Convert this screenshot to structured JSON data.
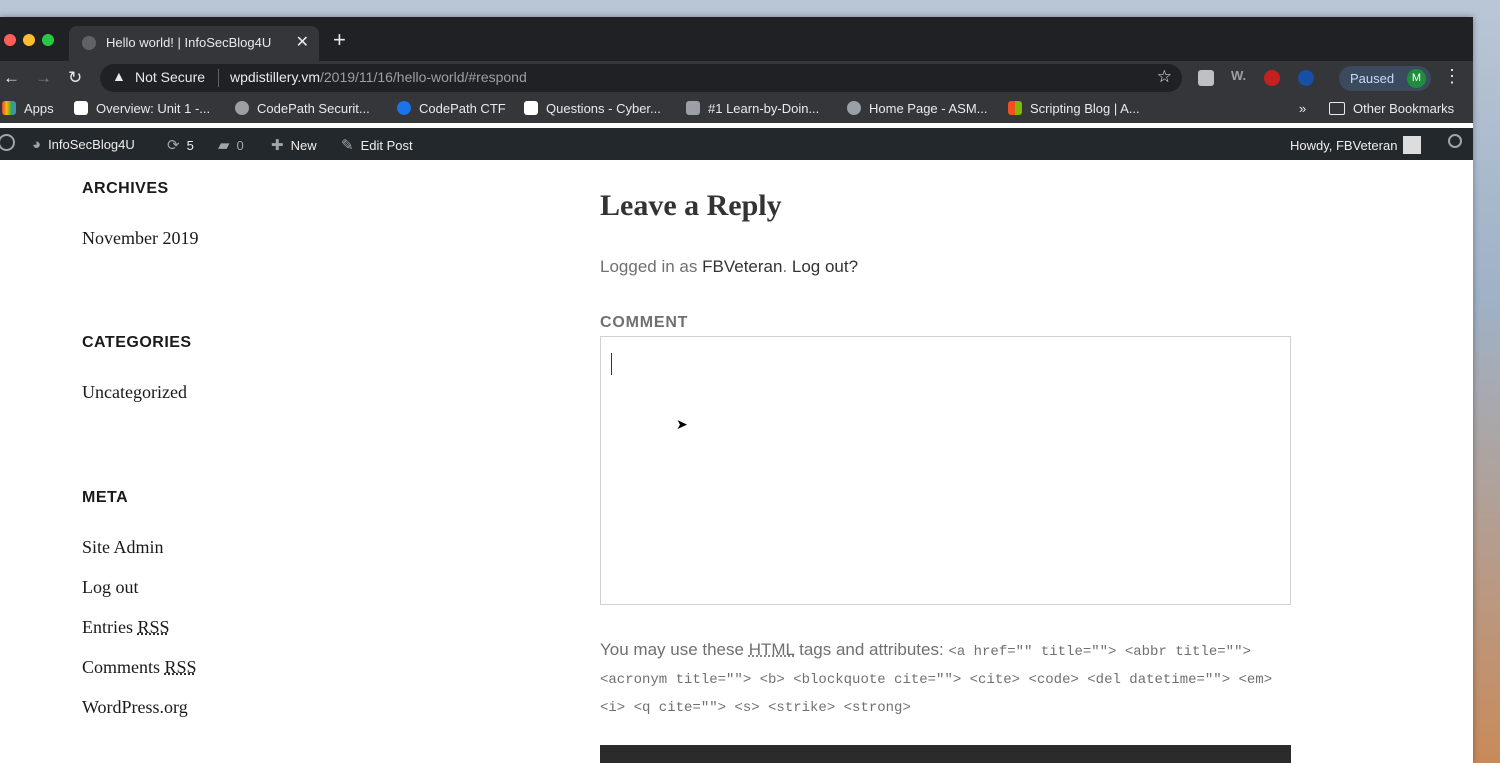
{
  "browser": {
    "tab_title": "Hello world! | InfoSecBlog4U",
    "tab_close": "✕",
    "new_tab": "+",
    "security_label": "Not Secure",
    "url_host": "wpdistillery.vm",
    "url_path": "/2019/11/16/hello-world/#respond",
    "profile_status": "Paused",
    "profile_initial": "M",
    "bookmarks": [
      {
        "label": "Apps",
        "color": "#ea4335"
      },
      {
        "label": "Overview: Unit 1 -...",
        "color": "#ffffff"
      },
      {
        "label": "CodePath Securit...",
        "color": "#9aa0a6"
      },
      {
        "label": "CodePath CTF",
        "color": "#1a73e8"
      },
      {
        "label": "Questions - Cyber...",
        "color": "#ffffff"
      },
      {
        "label": "#1 Learn-by-Doin...",
        "color": "#9aa0a6"
      },
      {
        "label": "Home Page - ASM...",
        "color": "#9aa0a6"
      },
      {
        "label": "Scripting Blog | A...",
        "color": "#f25022"
      }
    ],
    "bookmarks_overflow": "»",
    "other_bookmarks": "Other Bookmarks"
  },
  "adminbar": {
    "site_name": "InfoSecBlog4U",
    "updates_count": "5",
    "comments_count": "0",
    "new_label": "New",
    "edit_label": "Edit Post",
    "howdy": "Howdy, FBVeteran"
  },
  "sidebar": {
    "archives_title": "ARCHIVES",
    "archives_items": [
      "November 2019"
    ],
    "categories_title": "CATEGORIES",
    "categories_items": [
      "Uncategorized"
    ],
    "meta_title": "META",
    "meta_items": {
      "site_admin": "Site Admin",
      "log_out": "Log out",
      "entries": "Entries",
      "comments": "Comments",
      "rss": "RSS",
      "wordpress": "WordPress.org"
    }
  },
  "reply": {
    "heading": "Leave a Reply",
    "logged_prefix": "Logged in as",
    "user": "FBVeteran",
    "logout": "Log out?",
    "comment_label": "COMMENT",
    "comment_value": "",
    "allowed_prefix": "You may use these",
    "allowed_html": "HTML",
    "allowed_suffix": "tags and attributes:",
    "allowed_code": "<a href=\"\" title=\"\"> <abbr title=\"\"> <acronym title=\"\"> <b> <blockquote cite=\"\"> <cite> <code> <del datetime=\"\"> <em> <i> <q cite=\"\"> <s> <strike> <strong>"
  }
}
